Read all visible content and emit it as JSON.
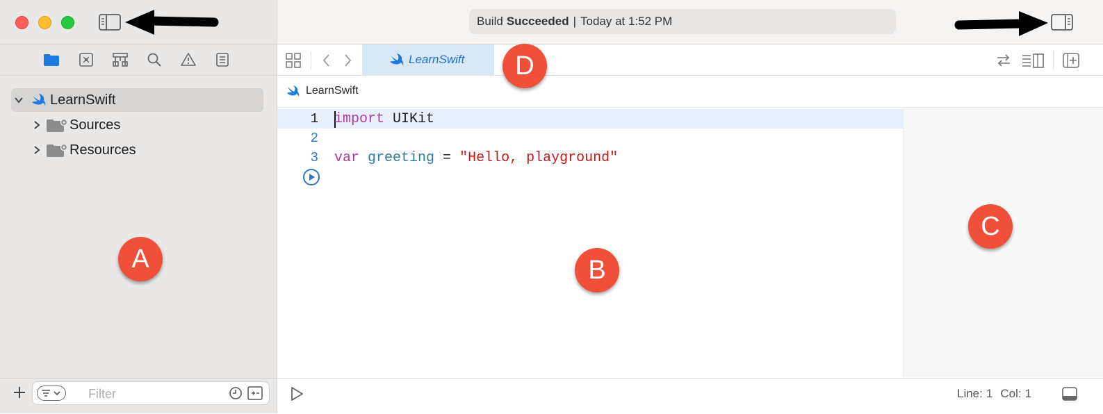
{
  "window": {
    "status": {
      "prefix": "Build",
      "emphasis": "Succeeded",
      "separator": "|",
      "time": "Today at 1:52 PM"
    }
  },
  "colors": {
    "close": "#fe5f57",
    "minimize": "#febc2e",
    "zoom": "#28c840",
    "accent": "#1f7ae0",
    "annotation": "#f04f3a"
  },
  "navigator": {
    "tabs": [
      "folder-icon",
      "source-control-icon",
      "hierarchy-icon",
      "search-icon",
      "warning-icon",
      "list-icon"
    ],
    "tree": [
      {
        "label": "LearnSwift",
        "icon": "swift-icon",
        "expanded": true
      },
      {
        "label": "Sources",
        "icon": "folder-gear-icon",
        "expanded": false
      },
      {
        "label": "Resources",
        "icon": "folder-gear-icon",
        "expanded": false
      }
    ],
    "filter": {
      "placeholder": "Filter"
    }
  },
  "editor": {
    "tab": {
      "label": "LearnSwift"
    },
    "breadcrumb": {
      "label": "LearnSwift"
    },
    "lines": [
      {
        "number": "1",
        "tokens": [
          {
            "t": "import",
            "k": "kw"
          },
          {
            "t": " UIKit",
            "k": "plain"
          }
        ]
      },
      {
        "number": "2",
        "tokens": []
      },
      {
        "number": "3",
        "tokens": [
          {
            "t": "var",
            "k": "kw"
          },
          {
            "t": " greeting",
            "k": "ident"
          },
          {
            "t": " = ",
            "k": "plain"
          },
          {
            "t": "\"Hello, playground\"",
            "k": "str"
          }
        ]
      }
    ],
    "cursor": {
      "line": "1",
      "col": "1"
    }
  },
  "statusbar": {
    "line_label": "Line:",
    "line": "1",
    "col_label": "Col:",
    "col": "1"
  },
  "annotations": {
    "a": "A",
    "b": "B",
    "c": "C",
    "d": "D"
  }
}
